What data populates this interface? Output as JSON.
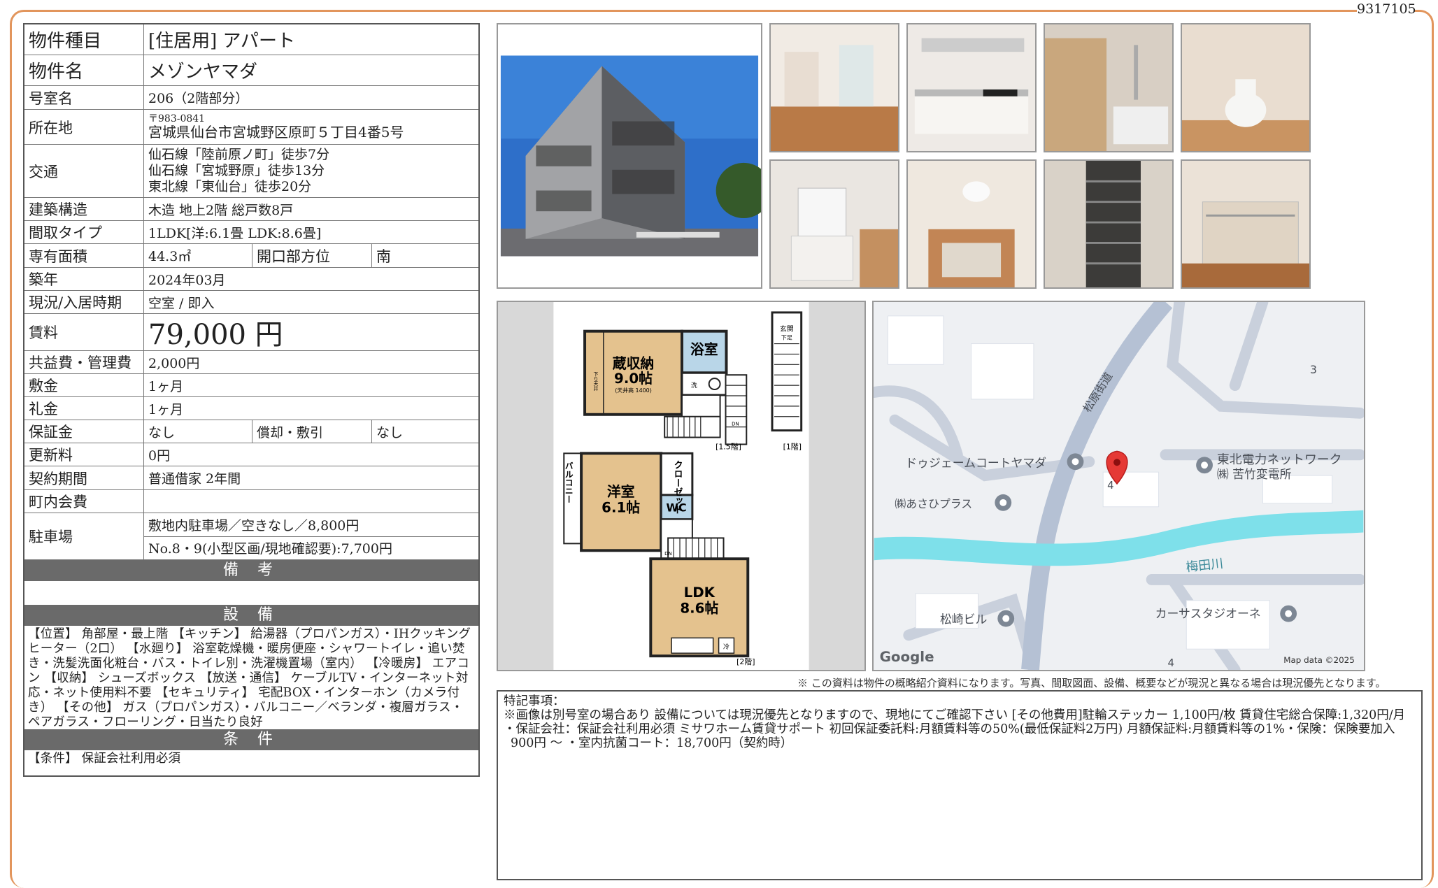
{
  "doc_id": "9317105",
  "spec": {
    "property_type": {
      "label": "物件種目",
      "value": "[住居用] アパート"
    },
    "property_name": {
      "label": "物件名",
      "value": "メゾンヤマダ"
    },
    "room_no": {
      "label": "号室名",
      "value": "206（2階部分）"
    },
    "address": {
      "label": "所在地",
      "postal": "〒983-0841",
      "value": "宮城県仙台市宮城野区原町５丁目4番5号"
    },
    "access": {
      "label": "交通",
      "lines": [
        "仙石線「陸前原ノ町」徒歩7分",
        "仙石線「宮城野原」徒歩13分",
        "東北線「東仙台」徒歩20分"
      ]
    },
    "structure": {
      "label": "建築構造",
      "value": "木造 地上2階 総戸数8戸"
    },
    "layout": {
      "label": "間取タイプ",
      "value": "1LDK[洋:6.1畳 LDK:8.6畳]"
    },
    "area": {
      "label": "専有面積",
      "value": "44.3㎡",
      "dir_label": "開口部方位",
      "dir_value": "南"
    },
    "built": {
      "label": "築年",
      "value": "2024年03月"
    },
    "status": {
      "label": "現況/入居時期",
      "value": "空室 / 即入"
    },
    "rent": {
      "label": "賃料",
      "value": "79,000 円"
    },
    "common_fee": {
      "label": "共益費・管理費",
      "value": "2,000円"
    },
    "deposit": {
      "label": "敷金",
      "value": "1ヶ月"
    },
    "key_money": {
      "label": "礼金",
      "value": "1ヶ月"
    },
    "guarantee": {
      "label": "保証金",
      "value": "なし",
      "amort_label": "償却・敷引",
      "amort_value": "なし"
    },
    "renewal": {
      "label": "更新料",
      "value": "0円"
    },
    "contract": {
      "label": "契約期間",
      "value": "普通借家 2年間"
    },
    "community_fee": {
      "label": "町内会費",
      "value": ""
    },
    "parking": {
      "label": "駐車場",
      "lines": [
        "敷地内駐車場／空きなし／8,800円",
        "No.8・9(小型区画/現地確認要):7,700円"
      ]
    }
  },
  "remarks": {
    "title": "備 考",
    "text": ""
  },
  "equipment": {
    "title": "設 備",
    "text": "【位置】 角部屋・最上階 【キッチン】 給湯器（プロパンガス）・IHクッキングヒーター（2口） 【水廻り】 浴室乾燥機・暖房便座・シャワートイレ・追い焚き・洗髪洗面化粧台・バス・トイレ別・洗濯機置場（室内） 【冷暖房】 エアコン 【収納】 シューズボックス 【放送・通信】 ケーブルTV・インターネット対応・ネット使用料不要 【セキュリティ】 宅配BOX・インターホン（カメラ付き） 【その他】 ガス（プロパンガス）・バルコニー／ベランダ・複層ガラス・ペアガラス・フローリング・日当たり良好"
  },
  "conditions": {
    "title": "条 件",
    "text": "【条件】 保証会社利用必須"
  },
  "floorplan": {
    "storage": "蔵収納",
    "storage_size": "9.0帖",
    "storage_note": "(天井高 1400)",
    "bath": "浴室",
    "western": "洋室",
    "western_size": "6.1帖",
    "closet": "クローゼット",
    "wc": "WC",
    "ldk": "LDK",
    "ldk_size": "8.6帖",
    "balcony": "バルコニー",
    "entrance": "玄関",
    "shoes": "下足",
    "level_15": "[1.5階]",
    "level_1": "[1階]",
    "level_2": "[2階]",
    "wash": "洗",
    "fridge": "冷",
    "dn": "DN",
    "up": "UP",
    "ceiling": "下り天井"
  },
  "map": {
    "labels": [
      "ドゥジェームコートヤマダ",
      "㈱あさひプラス",
      "東北電力ネットワーク",
      "㈱ 苦竹変電所",
      "松崎ビル",
      "カーサスタジオーネ",
      "梅田川",
      "松原街道"
    ],
    "numbers": [
      "3",
      "4",
      "4"
    ],
    "google": "Google",
    "map_data": "Map data ©2025"
  },
  "disclaimer": "※ この資料は物件の概略紹介資料になります。写真、間取図面、設備、概要などが現況と異なる場合は現況優先となります。",
  "notes": {
    "title": "特記事項：",
    "lines": [
      "※画像は別号室の場合あり 設備については現況優先となりますので、現地にてご確認下さい [その他費用]駐輪ステッカー 1,100円/枚 賃貸住宅総合保障:1,320円/月",
      "・保証会社：保証会社利用必須 ミサワホーム賃貸サポート 初回保証委託料:月額賃料等の50%(最低保証料2万円) 月額保証料:月額賃料等の1%・保険：保険要加入 900円 〜 ・室内抗菌コート：18,700円（契約時）"
    ]
  }
}
